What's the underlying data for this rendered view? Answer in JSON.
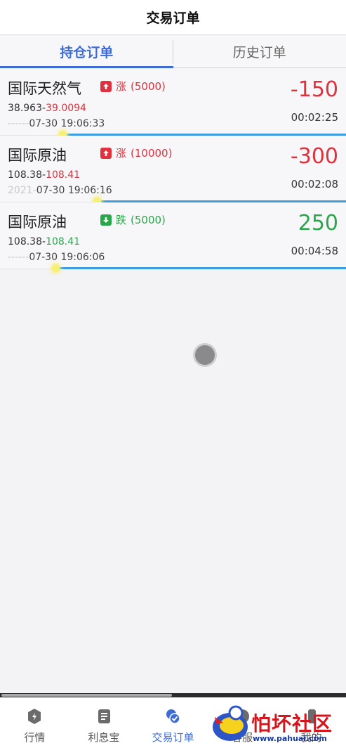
{
  "header": {
    "title": "交易订单"
  },
  "tabs": [
    {
      "label": "持仓订单",
      "active": true
    },
    {
      "label": "历史订单",
      "active": false
    }
  ],
  "orders": [
    {
      "name": "国际天然气",
      "direction": "涨",
      "quantity": "(5000)",
      "open_price": "38.963",
      "separator": "-",
      "current_price": "39.0094",
      "price_color": "red",
      "date_hidden": "------",
      "datetime": "07-30 19:06:33",
      "profit_loss": "-150",
      "pl_color": "red",
      "countdown": "00:02:25",
      "progress_remaining": 0.82
    },
    {
      "name": "国际原油",
      "direction": "涨",
      "quantity": "(10000)",
      "open_price": "108.38",
      "separator": "-",
      "current_price": "108.41",
      "price_color": "red",
      "date_hidden": "2021-",
      "datetime": "07-30 19:06:16",
      "profit_loss": "-300",
      "pl_color": "red",
      "countdown": "00:02:08",
      "progress_remaining": 0.72
    },
    {
      "name": "国际原油",
      "direction": "跌",
      "quantity": "(5000)",
      "open_price": "108.38",
      "separator": "-",
      "current_price": "108.41",
      "price_color": "green",
      "date_hidden": "------",
      "datetime": "07-30 19:06:06",
      "profit_loss": "250",
      "pl_color": "green",
      "countdown": "00:04:58",
      "progress_remaining": 0.84
    }
  ],
  "bottom_nav": [
    {
      "label": "行情",
      "icon": "market-icon",
      "active": false
    },
    {
      "label": "利息宝",
      "icon": "interest-icon",
      "active": false
    },
    {
      "label": "交易订单",
      "icon": "orders-icon",
      "active": true
    },
    {
      "label": "客服",
      "icon": "service-icon",
      "active": false
    },
    {
      "label": "我的",
      "icon": "profile-icon",
      "active": false
    }
  ],
  "watermark": {
    "text": "怕坏社区",
    "url": "www.pahuai.com"
  },
  "colors": {
    "accent": "#3d6bd8",
    "up": "#e0313c",
    "down": "#2aa74a",
    "progress": "#3a9ee0"
  }
}
